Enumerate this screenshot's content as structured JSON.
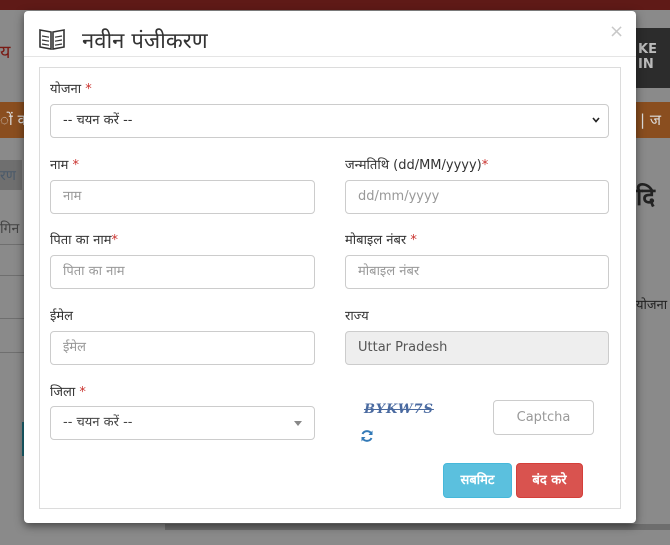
{
  "modal": {
    "title": "नवीन पंजीकरण",
    "close_symbol": "×"
  },
  "form": {
    "scheme": {
      "label": "योजना",
      "required": "*",
      "value": "-- चयन करें --"
    },
    "name": {
      "label": "नाम",
      "required": "*",
      "placeholder": "नाम"
    },
    "dob": {
      "label": "जन्मतिथि (dd/MM/yyyy)",
      "required": "*",
      "placeholder": "dd/mm/yyyy"
    },
    "father_name": {
      "label": "पिता का नाम",
      "required": "*",
      "placeholder": "पिता का नाम"
    },
    "mobile": {
      "label": "मोबाइल नंबर",
      "required": "*",
      "placeholder": "मोबाइल नंबर"
    },
    "email": {
      "label": "ईमेल",
      "placeholder": "ईमेल"
    },
    "state": {
      "label": "राज्य",
      "value": "Uttar Pradesh"
    },
    "district": {
      "label": "जिला",
      "required": "*",
      "value": "-- चयन करें --"
    },
    "captcha": {
      "image_text": "BYKW7S",
      "placeholder": "Captcha"
    }
  },
  "buttons": {
    "submit": "सबमिट",
    "close": "बंद करे"
  },
  "background": {
    "top_text": "...",
    "left_brand": "य",
    "orange_left": "ों का",
    "orange_right": "| ज",
    "left_item_1": "रण",
    "left_item_2": "गिन",
    "right_heading": "दि",
    "right_text": "योजना",
    "right_logo_text": "KE IN"
  },
  "colors": {
    "submit": "#5bc0de",
    "close": "#d9534f",
    "required": "#c9302c"
  }
}
